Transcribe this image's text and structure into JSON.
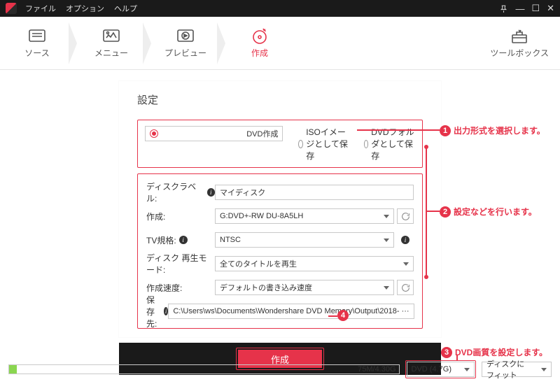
{
  "menu": {
    "file": "ファイル",
    "options": "オプション",
    "help": "ヘルプ"
  },
  "steps": {
    "source": "ソース",
    "menu": "メニュー",
    "preview": "プレビュー",
    "create": "作成",
    "toolbox": "ツールボックス"
  },
  "panel_title": "設定",
  "formats": {
    "dvd": "DVD作成",
    "iso": "ISOイメージとして保存",
    "folder": "DVDフォルダとして保存"
  },
  "fields": {
    "disc_label_lbl": "ディスクラベル:",
    "disc_label_val": "マイディスク",
    "create_lbl": "作成:",
    "create_val": "G:DVD+-RW DU-8A5LH",
    "tv_lbl": "TV規格:",
    "tv_val": "NTSC",
    "playmode_lbl": "ディスク 再生モード:",
    "playmode_val": "全てのタイトルを再生",
    "speed_lbl": "作成速度:",
    "speed_val": "デフォルトの書き込み速度",
    "saveto_lbl": "保存先:",
    "saveto_val": "C:\\Users\\ws\\Documents\\Wondershare DVD Memory\\Output\\2018- ···"
  },
  "create_btn": "作成",
  "capacity_text": "75M/4.30G",
  "dvd_size": "DVD (4.7G)",
  "fit": "ディスクにフィット",
  "callouts": {
    "c1": "出力形式を選択します。",
    "c2": "設定などを行います。",
    "c3": "DVD画質を設定します。",
    "c4": "4"
  }
}
